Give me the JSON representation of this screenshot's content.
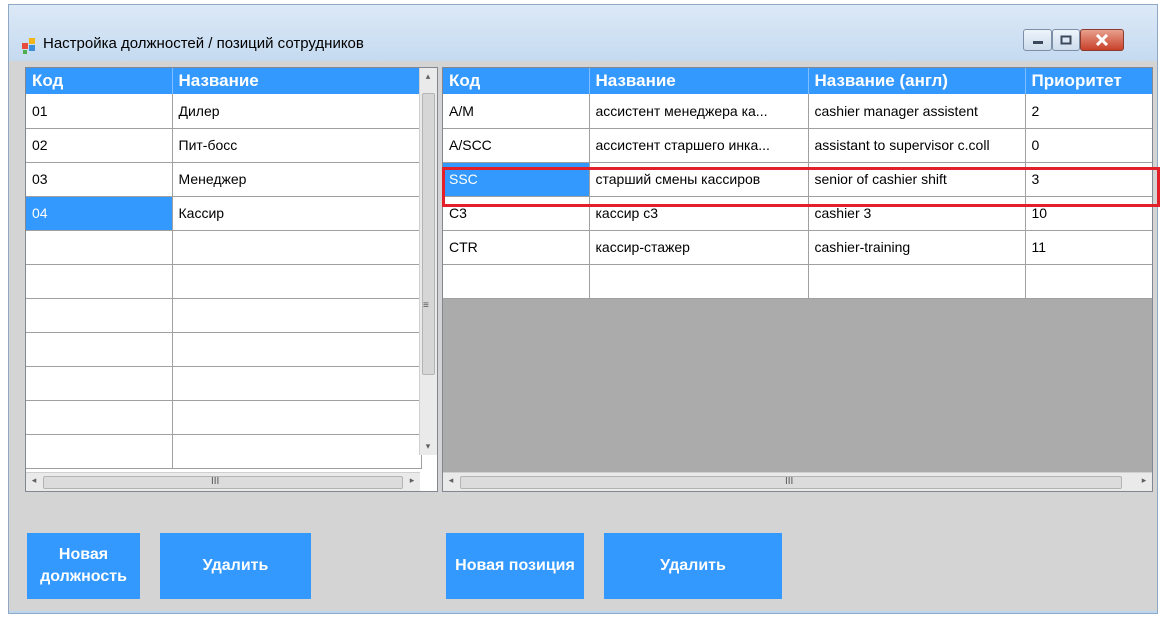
{
  "window": {
    "title": "Настройка должностей / позиций сотрудников"
  },
  "positions_grid": {
    "columns": [
      "Код",
      "Название"
    ],
    "rows": [
      {
        "code": "01",
        "name": "Дилер"
      },
      {
        "code": "02",
        "name": "Пит-босс"
      },
      {
        "code": "03",
        "name": "Менеджер"
      },
      {
        "code": "04",
        "name": "Кассир",
        "selected": true
      }
    ],
    "empty_rows": 7
  },
  "roles_grid": {
    "columns": [
      "Код",
      "Название",
      "Название (англ)",
      "Приоритет"
    ],
    "rows": [
      {
        "code": "A/M",
        "name": "ассистент менеджера ка...",
        "name_en": "cashier manager assistent",
        "priority": "2"
      },
      {
        "code": "A/SCC",
        "name": "ассистент старшего инка...",
        "name_en": "assistant to supervisor c.coll",
        "priority": "0"
      },
      {
        "code": "SSC",
        "name": "старший смены кассиров",
        "name_en": "senior of cashier shift",
        "priority": "3",
        "selected": true
      },
      {
        "code": "C3",
        "name": "кассир с3",
        "name_en": "cashier 3",
        "priority": "10"
      },
      {
        "code": "CTR",
        "name": "кассир-стажер",
        "name_en": "cashier-training",
        "priority": "11"
      }
    ],
    "empty_rows": 1
  },
  "buttons": {
    "new_position": "Новая должность",
    "delete_position": "Удалить",
    "new_role": "Новая позиция",
    "delete_role": "Удалить"
  },
  "scrollbar_glyphs": {
    "left_arrow": "◂",
    "right_arrow": "▸",
    "up_arrow": "▴",
    "down_arrow": "▾",
    "grip_h": "III",
    "grip_v": "≡"
  },
  "colors": {
    "accent": "#3399ff",
    "highlight": "#e3202a",
    "client_bg": "#d4d4d4"
  }
}
